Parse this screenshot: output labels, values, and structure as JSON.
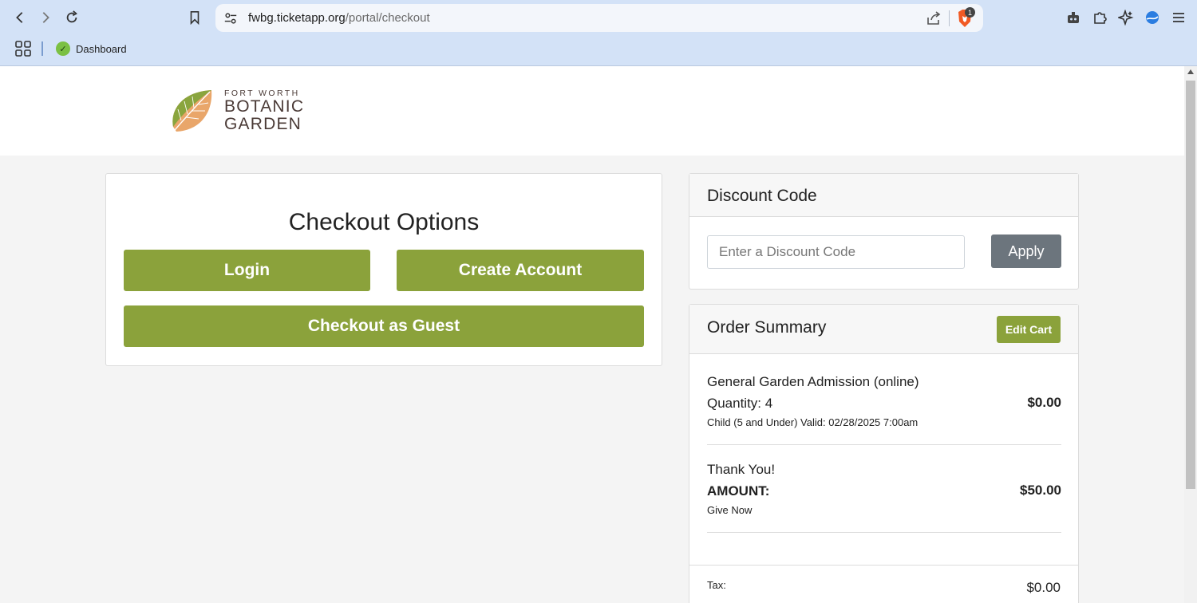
{
  "browser": {
    "url_host": "fwbg.ticketapp.org",
    "url_path": "/portal/checkout",
    "brave_badge": "1",
    "bookmark_label": "Dashboard"
  },
  "logo": {
    "small": "FORT WORTH",
    "line1": "BOTANIC",
    "line2": "GARDEN"
  },
  "checkout": {
    "title": "Checkout Options",
    "login": "Login",
    "create_account": "Create Account",
    "guest": "Checkout as Guest"
  },
  "discount": {
    "title": "Discount Code",
    "placeholder": "Enter a Discount Code",
    "apply": "Apply"
  },
  "summary": {
    "title": "Order Summary",
    "edit_cart": "Edit Cart",
    "items": [
      {
        "name": "General Garden Admission (online)",
        "qty": "Quantity: 4",
        "detail": "Child (5 and Under) Valid: 02/28/2025 7:00am",
        "price": "$0.00"
      },
      {
        "name": "Thank You!",
        "qty": "AMOUNT:",
        "detail": "Give Now",
        "price": "$50.00"
      }
    ],
    "tax_label": "Tax:",
    "tax_value": "$0.00"
  },
  "colors": {
    "accent": "#8ba23b",
    "secondary": "#6c757d"
  }
}
